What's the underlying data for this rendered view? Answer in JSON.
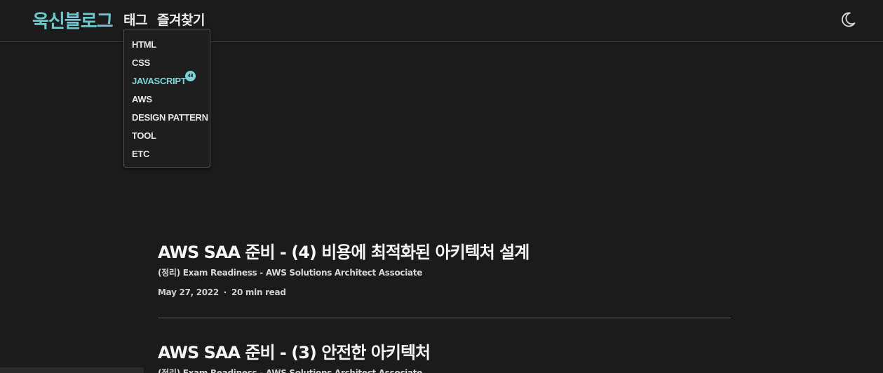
{
  "header": {
    "logo": "욱신블로그",
    "nav": {
      "tags": "태그",
      "favorites": "즐겨찾기"
    },
    "theme_icon": "moon-icon"
  },
  "dropdown": {
    "items": [
      {
        "label": "HTML"
      },
      {
        "label": "CSS"
      },
      {
        "label": "JAVASCRIPT",
        "badge": "48",
        "active": true
      },
      {
        "label": "AWS"
      },
      {
        "label": "DESIGN PATTERN"
      },
      {
        "label": "TOOL"
      },
      {
        "label": "ETC"
      }
    ]
  },
  "posts": [
    {
      "title": "AWS SAA 준비 - (4) 비용에 최적화된 아키텍처 설계",
      "description": "(정리) Exam Readiness - AWS Solutions Architect Associate",
      "date": "May 27, 2022",
      "separator": "·",
      "read_time": "20 min read"
    },
    {
      "title": "AWS SAA 준비 - (3) 안전한 아키텍처",
      "description": "(정리) Exam Readiness - AWS Solutions Architect Associate"
    }
  ],
  "colors": {
    "accent": "#6ec9cf",
    "background": "#1b1b1b"
  }
}
